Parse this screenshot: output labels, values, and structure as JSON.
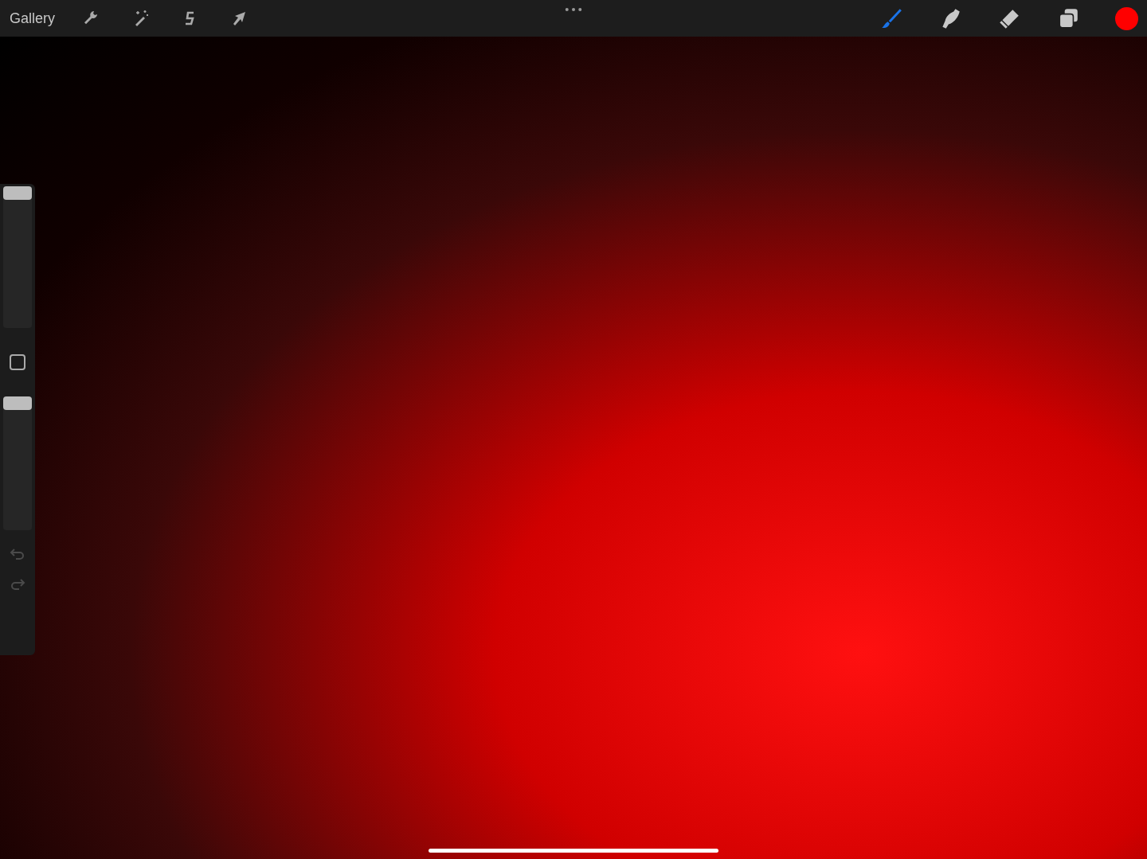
{
  "toolbar": {
    "gallery": "Gallery",
    "actions": [
      {
        "kind": "wrench"
      },
      {
        "kind": "wand"
      },
      {
        "kind": "selection"
      },
      {
        "kind": "transform"
      }
    ],
    "tools": [
      {
        "kind": "brush",
        "selected": true
      },
      {
        "kind": "smudge",
        "selected": false
      },
      {
        "kind": "eraser",
        "selected": false
      },
      {
        "kind": "layers",
        "selected": false
      }
    ],
    "current_color": {
      "color": "#ff0000"
    }
  },
  "sidebar": {
    "brush_size": {
      "level": 1
    },
    "opacity": {
      "level": 1
    }
  }
}
